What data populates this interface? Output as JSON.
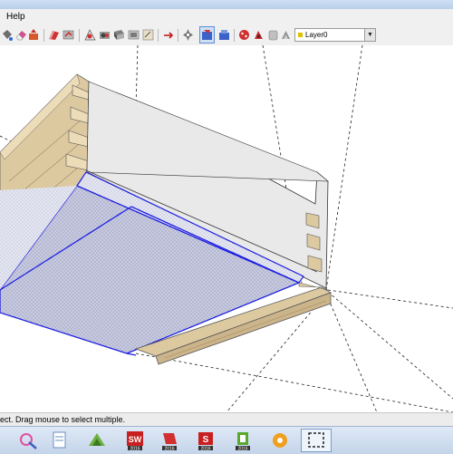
{
  "menubar": {
    "help_label": "Help"
  },
  "toolbar": {
    "buttons": [
      "paint-bucket-icon",
      "eraser-icon",
      "push-pull-icon",
      "follow-me-icon",
      "move-icon",
      "rotate-icon",
      "scale-icon",
      "offset-icon",
      "tape-measure-icon",
      "dimension-icon",
      "protractor-icon",
      "text-icon",
      "axes-icon",
      "3d-text-icon",
      "orbit-icon",
      "pan-icon",
      "zoom-icon",
      "zoom-extents-icon",
      "get-models-icon",
      "share-model-icon",
      "component-icon",
      "extension-icon"
    ],
    "layer": {
      "value": "Layer0",
      "swatch_color": "#e0c000"
    }
  },
  "viewport": {
    "wood_color": "#dcc9a0",
    "side_color": "#e9e9ea",
    "selection_color": "#2020e0",
    "selected_fill": "#c6c9df"
  },
  "statusbar": {
    "text": "ect. Drag mouse to select multiple."
  },
  "taskbar": {
    "apps": [
      {
        "name": "paint-icon",
        "label": ""
      },
      {
        "name": "document-icon",
        "label": ""
      },
      {
        "name": "sketchup-2016-layout-icon",
        "label": ""
      },
      {
        "name": "solidworks-2016-icon",
        "label": "SW 2016"
      },
      {
        "name": "sketchup-2016-icon-a",
        "label": "2016"
      },
      {
        "name": "sketchup-2016-icon-b",
        "label": "2016"
      },
      {
        "name": "sketchup-2016-icon-c",
        "label": "2016"
      },
      {
        "name": "style-builder-2016-icon",
        "label": "2016"
      },
      {
        "name": "settings-gear-icon",
        "label": ""
      },
      {
        "name": "screen-capture-icon",
        "label": ""
      }
    ]
  }
}
